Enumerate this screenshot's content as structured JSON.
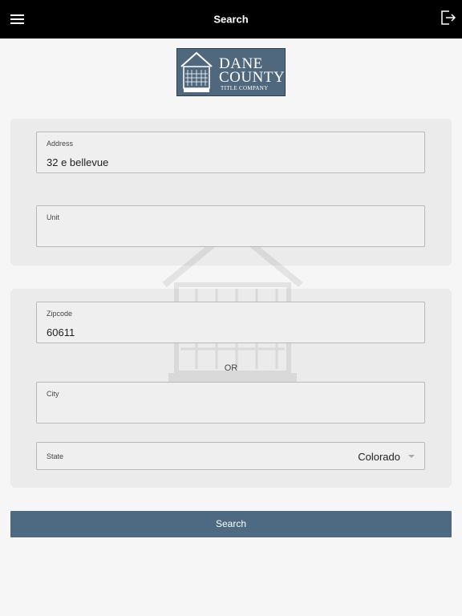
{
  "header": {
    "title": "Search",
    "menu_icon": "hamburger-menu-icon",
    "logout_icon": "logout-icon"
  },
  "logo": {
    "line1": "DANE",
    "line2": "COUNTY",
    "line3": "TITLE COMPANY"
  },
  "form": {
    "address": {
      "label": "Address",
      "value": "32 e bellevue"
    },
    "unit": {
      "label": "Unit",
      "value": ""
    },
    "zipcode": {
      "label": "Zipcode",
      "value": "60611"
    },
    "or_text": "OR",
    "city": {
      "label": "City",
      "value": ""
    },
    "state": {
      "label": "State",
      "value": "Colorado"
    }
  },
  "search_button": {
    "label": "Search"
  },
  "colors": {
    "topbar": "#000000",
    "accent": "#4e6a82",
    "card": "#ebebeb",
    "background": "#f6f6f6"
  }
}
